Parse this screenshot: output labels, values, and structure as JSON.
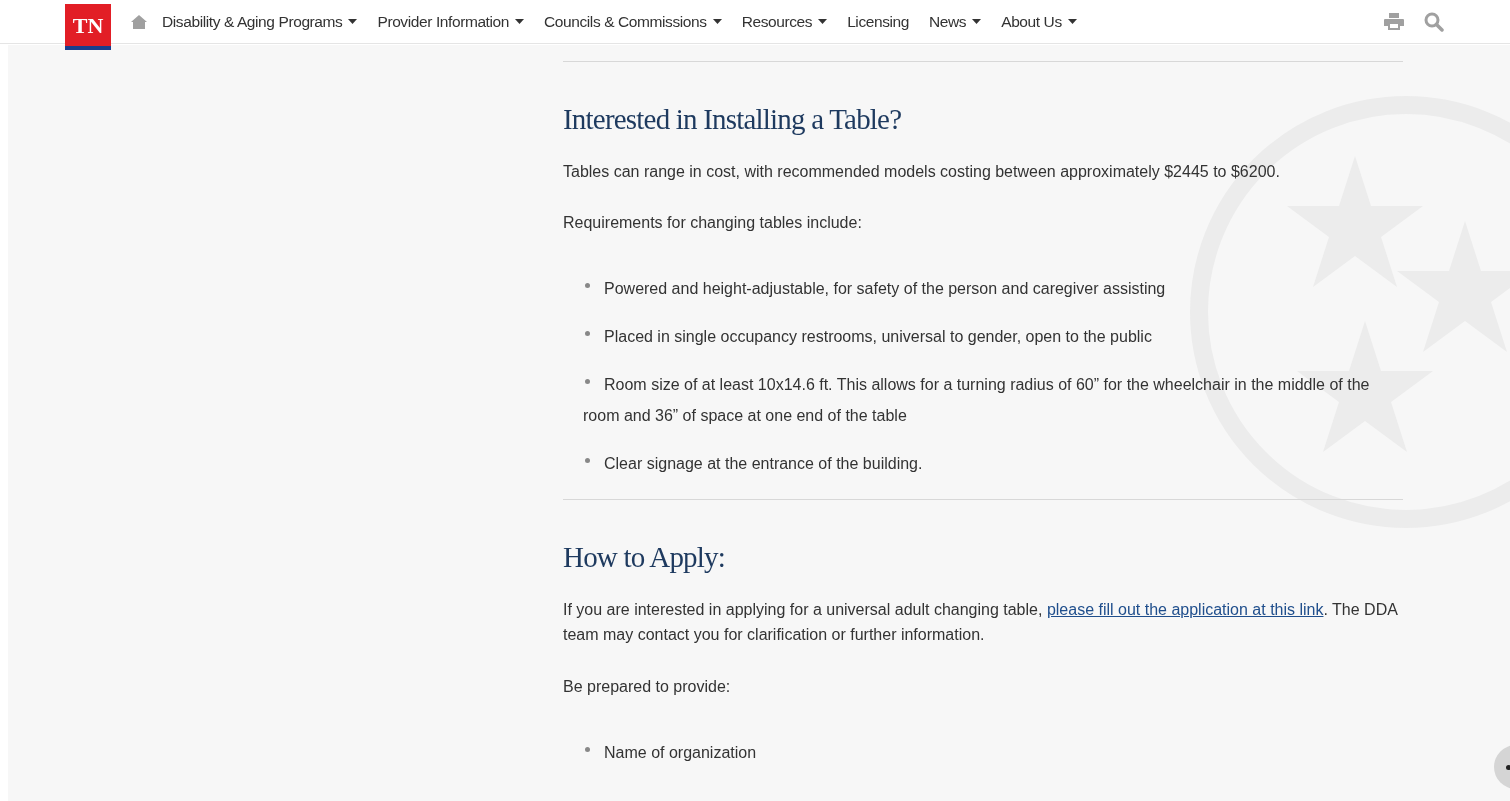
{
  "nav": {
    "logo": "TN",
    "items": [
      {
        "label": "Disability & Aging Programs",
        "dropdown": true
      },
      {
        "label": "Provider Information",
        "dropdown": true
      },
      {
        "label": "Councils & Commissions",
        "dropdown": true
      },
      {
        "label": "Resources",
        "dropdown": true
      },
      {
        "label": "Licensing",
        "dropdown": false
      },
      {
        "label": "News",
        "dropdown": true
      },
      {
        "label": "About Us",
        "dropdown": true
      }
    ]
  },
  "sections": [
    {
      "heading": "Interested in Installing a Table?",
      "blocks": [
        {
          "kind": "paragraph",
          "text": "Tables can range in cost, with recommended models costing between approximately $2445 to $6200."
        },
        {
          "kind": "paragraph",
          "text": "Requirements for changing tables include:"
        },
        {
          "kind": "list",
          "items": [
            "Powered and height-adjustable, for safety of the person and caregiver assisting",
            "Placed in single occupancy restrooms, universal to gender, open to the public",
            "Room size of at least 10x14.6 ft.  This allows for a turning radius of 60” for the wheelchair in the middle of the room and 36” of space at one end of the table",
            "Clear signage at the entrance of the building."
          ]
        }
      ]
    },
    {
      "heading": "How to Apply:",
      "blocks": [
        {
          "kind": "link_paragraph",
          "before": "If you are interested in applying for a universal adult changing table,",
          "link": "please fill out the application at this link",
          "after": ". The DDA team may contact you for clarification or further information."
        },
        {
          "kind": "paragraph",
          "text": "Be prepared to provide:"
        },
        {
          "kind": "list",
          "items": [
            "Name of organization"
          ]
        }
      ]
    }
  ]
}
